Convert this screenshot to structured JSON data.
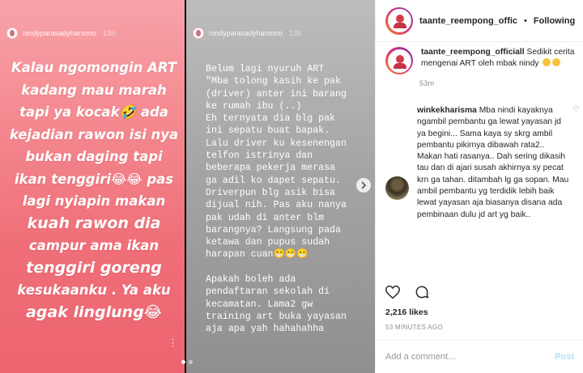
{
  "post": {
    "username": "taante_reempong_offic",
    "follow_label": "Following",
    "separator": "•",
    "caption_user": "taante_reempong_officiall",
    "caption_text": "Sedikit cerita mengenai ART oleh mbak nindy",
    "caption_time": "53m",
    "likes": "2,216 likes",
    "timestamp": "53 MINUTES AGO",
    "comment_placeholder": "Add a comment…",
    "post_label": "Post"
  },
  "comments": [
    {
      "username": "winkekharisma",
      "text": "Mba nindi kayaknya ngambil pembantu ga lewat yayasan jd ya begini... Sama kaya sy skrg ambil pembantu pikirnya dibawah rata2.. Makan hati rasanya.. Dah sering dikasih tau dan di ajari susah akhirnya sy pecat krn ga tahan. ditambah lg ga sopan. Mau ambil pembantu yg terdidik lebih baik lewat yayasan aja biasanya disana ada pembinaan dulu jd art yg baik.."
    }
  ],
  "story1": {
    "user": "nindyparasadyharsono",
    "time": "13h",
    "lines": [
      "Kalau ngomongin ART",
      "kadang mau marah",
      "tapi ya kocak🤣 ada",
      "kejadian rawon isi nya",
      "bukan daging tapi",
      "ikan tenggiri😂😂 pas",
      "lagi nyiapin makan",
      "kuah rawon dia",
      "campur ama ikan",
      "tenggiri goreng",
      "kesukaanku . Ya aku",
      "agak linglung😂"
    ]
  },
  "story2": {
    "user": "nindyparasadyharsono",
    "time": "13h",
    "text": "Belum lagi nyuruh ART\n\"Mba tolong kasih ke pak\n(driver) anter ini barang\nke rumah ibu (..)\nEh ternyata dia blg pak\nini sepatu buat bapak.\nLalu driver ku kesenengan\ntelfon istrinya dan\nbeberapa pekerja merasa\nga adil ko dapet sepatu.\nDriverpun blg asik bisa\ndijual nih. Pas aku nanya\npak udah di anter blm\nbarangnya? Langsung pada\nketawa dan pupus sudah\nharapan cuan😁😁😁\n\nApakah boleh ada\npendaftaran sekolah di\nkecamatan. Lama2 gw\ntraining art buka yayasan\naja apa yah hahahahha"
  },
  "icons": {
    "heart": "heart-icon",
    "comment": "comment-bubble-icon",
    "next": "chevron-right-icon"
  }
}
